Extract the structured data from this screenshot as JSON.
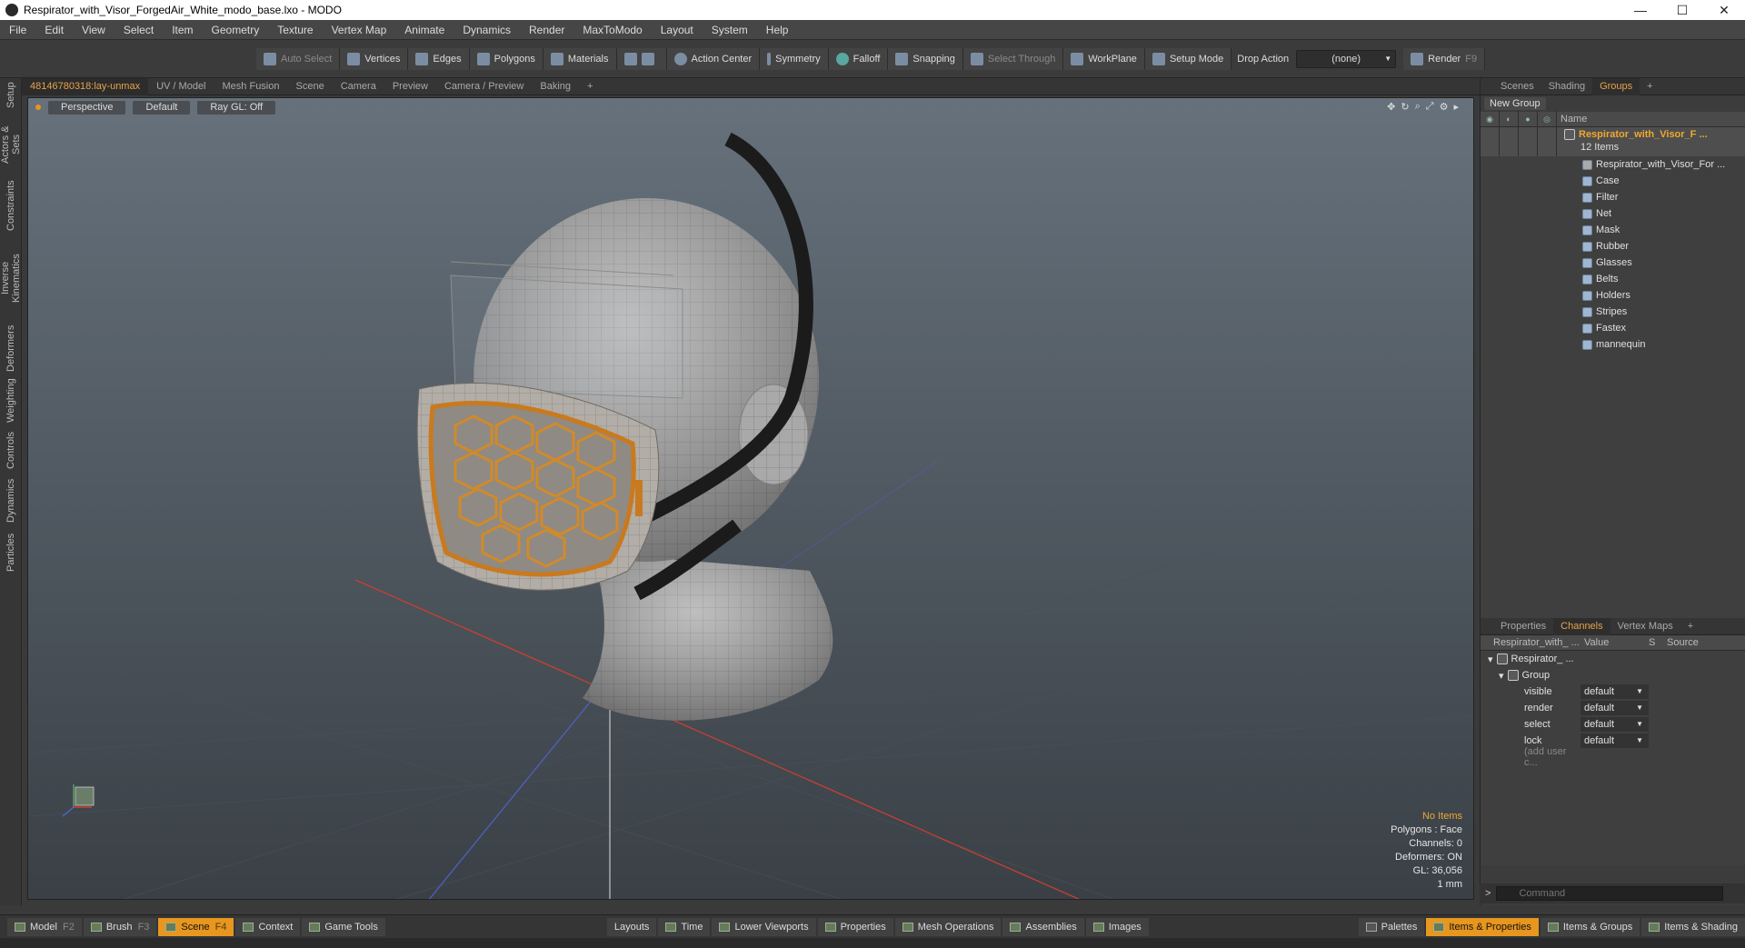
{
  "window": {
    "title": "Respirator_with_Visor_ForgedAir_White_modo_base.lxo - MODO",
    "minimize": "—",
    "maximize": "☐",
    "close": "✕"
  },
  "menu": [
    "File",
    "Edit",
    "View",
    "Select",
    "Item",
    "Geometry",
    "Texture",
    "Vertex Map",
    "Animate",
    "Dynamics",
    "Render",
    "MaxToModo",
    "Layout",
    "System",
    "Help"
  ],
  "toolbar": {
    "auto_select": "Auto Select",
    "vertices": "Vertices",
    "edges": "Edges",
    "polygons": "Polygons",
    "materials": "Materials",
    "action_center": "Action Center",
    "symmetry": "Symmetry",
    "falloff": "Falloff",
    "snapping": "Snapping",
    "select_through": "Select Through",
    "workplane": "WorkPlane",
    "setup_mode": "Setup Mode",
    "drop_action_label": "Drop Action",
    "drop_action_value": "(none)",
    "render": "Render",
    "render_key": "F9"
  },
  "left_tabs": [
    "Setup",
    "Actors & Sets",
    "Constraints",
    "Inverse Kinematics",
    "Deformers",
    "Weighting",
    "Controls",
    "Dynamics",
    "Particles"
  ],
  "viewport_tabs": [
    "48146780318:lay-unmax",
    "UV / Model",
    "Mesh Fusion",
    "Scene",
    "Camera",
    "Preview",
    "Camera / Preview",
    "Baking",
    "+"
  ],
  "viewport": {
    "view": "Perspective",
    "shading": "Default",
    "raygl": "Ray GL: Off",
    "info": {
      "items": "No Items",
      "polygons": "Polygons : Face",
      "channels": "Channels: 0",
      "deformers": "Deformers: ON",
      "gl": "GL: 36,056",
      "units": "1 mm"
    }
  },
  "right_top_tabs": [
    "Scenes",
    "Shading",
    "Groups",
    "+"
  ],
  "groups": {
    "new_group": "New Group",
    "name_header": "Name",
    "root_name": "Respirator_with_Visor_F ...",
    "root_count": "12 Items",
    "items": [
      "Respirator_with_Visor_For ...",
      "Case",
      "Filter",
      "Net",
      "Mask",
      "Rubber",
      "Glasses",
      "Belts",
      "Holders",
      "Stripes",
      "Fastex",
      "mannequin"
    ]
  },
  "right_bottom_tabs": [
    "Properties",
    "Channels",
    "Vertex Maps",
    "+"
  ],
  "channels": {
    "headers": [
      "Respirator_with_ ...",
      "Value",
      "S",
      "Source"
    ],
    "tree_root": "Respirator_ ...",
    "tree_group": "Group",
    "rows": [
      {
        "name": "visible",
        "value": "default"
      },
      {
        "name": "render",
        "value": "default"
      },
      {
        "name": "select",
        "value": "default"
      },
      {
        "name": "lock",
        "value": "default"
      }
    ],
    "add_user": "(add user c..."
  },
  "command": {
    "prompt": ">",
    "placeholder": "Command"
  },
  "bottom_left": [
    {
      "label": "Model",
      "key": "F2"
    },
    {
      "label": "Brush",
      "key": "F3"
    },
    {
      "label": "Scene",
      "key": "F4",
      "active": true
    },
    {
      "label": "Context",
      "key": ""
    },
    {
      "label": "Game Tools",
      "key": ""
    }
  ],
  "bottom_mid": [
    "Layouts",
    "Time",
    "Lower Viewports",
    "Properties",
    "Mesh Operations",
    "Assemblies",
    "Images"
  ],
  "bottom_right": [
    {
      "label": "Palettes"
    },
    {
      "label": "Items & Properties",
      "active": true
    },
    {
      "label": "Items & Groups"
    },
    {
      "label": "Items & Shading"
    }
  ],
  "colors": {
    "accent": "#e7961f",
    "active_tab": "#e7a24a",
    "viewport_top": "#66717b",
    "viewport_bottom": "#3a4046",
    "mask_frame": "#c97a1e"
  }
}
